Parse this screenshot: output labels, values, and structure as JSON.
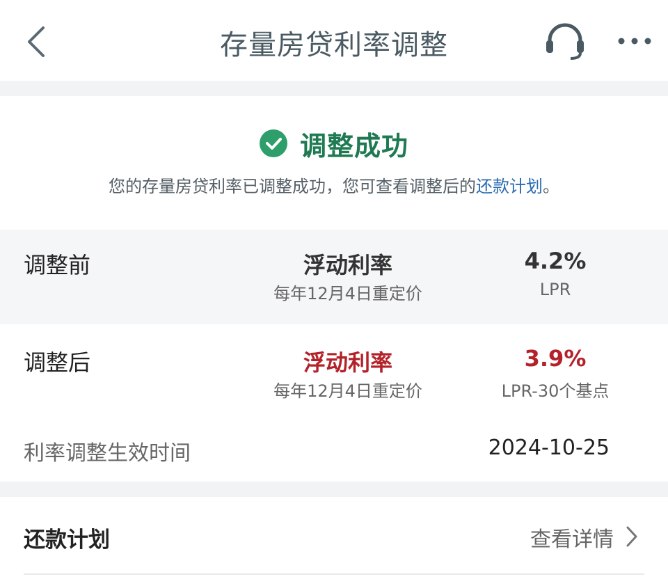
{
  "header": {
    "title": "存量房贷利率调整"
  },
  "result": {
    "status": "调整成功",
    "description_prefix": "您的存量房贷利率已调整成功，您可查看调整后的",
    "description_link": "还款计划",
    "description_suffix": "。"
  },
  "before": {
    "label": "调整前",
    "rate_type": "浮动利率",
    "rate_type_note": "每年12月4日重定价",
    "rate": "4.2%",
    "rate_basis": "LPR"
  },
  "after": {
    "label": "调整后",
    "rate_type": "浮动利率",
    "rate_type_note": "每年12月4日重定价",
    "rate": "3.9%",
    "rate_basis": "LPR-30个基点"
  },
  "effective": {
    "label": "利率调整生效时间",
    "value": "2024-10-25"
  },
  "repayment_plan": {
    "label": "还款计划",
    "detail": "查看详情"
  },
  "icons": {
    "back": "chevron-left-icon",
    "support": "headset-icon",
    "more": "more-dots-icon",
    "success": "check-circle-icon",
    "forward": "chevron-right-icon"
  },
  "colors": {
    "success_green": "#2e9e6b",
    "status_text_green": "#1f7a52",
    "highlight_red": "#b3222a",
    "link_blue": "#2a6bb0"
  }
}
